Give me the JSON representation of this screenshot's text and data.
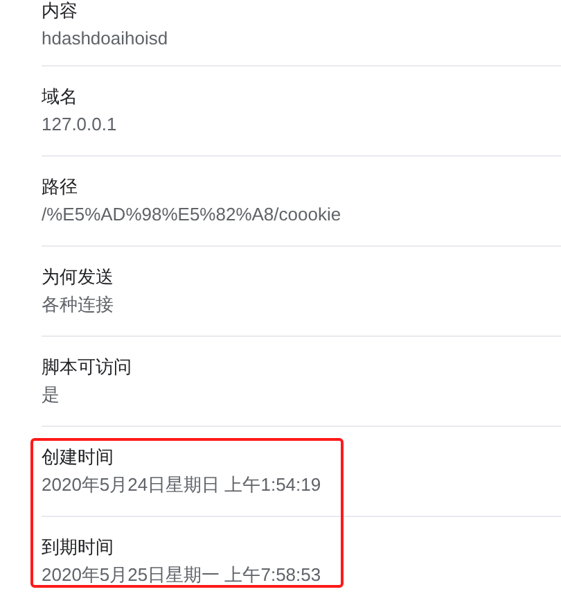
{
  "fields": [
    {
      "label": "内容",
      "value": "hdashdoaihoisd",
      "highlighted": false
    },
    {
      "label": "域名",
      "value": "127.0.0.1",
      "highlighted": false
    },
    {
      "label": "路径",
      "value": "/%E5%AD%98%E5%82%A8/coookie",
      "highlighted": false
    },
    {
      "label": "为何发送",
      "value": "各种连接",
      "highlighted": false
    },
    {
      "label": "脚本可访问",
      "value": "是",
      "highlighted": false
    },
    {
      "label": "创建时间",
      "value": "2020年5月24日星期日 上午1:54:19",
      "highlighted": true
    },
    {
      "label": "到期时间",
      "value": "2020年5月25日星期一 上午7:58:53",
      "highlighted": true
    }
  ]
}
